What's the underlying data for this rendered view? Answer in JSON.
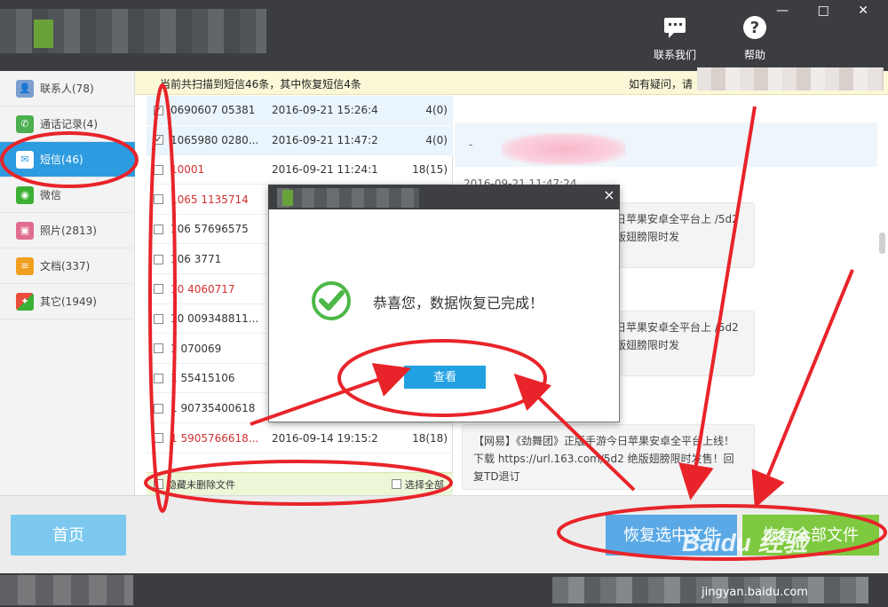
{
  "header": {
    "contact_label": "联系我们",
    "help_label": "帮助",
    "window_controls": "— □ ✕"
  },
  "banner": {
    "text": "当前共扫描到短信46条，其中恢复短信4条",
    "help_text": "如有疑问，请"
  },
  "sidebar": {
    "items": [
      {
        "label": "联系人(78)",
        "icon": "contacts-icon",
        "color": "#7a9fd0"
      },
      {
        "label": "通话记录(4)",
        "icon": "call-log-icon",
        "color": "#4caf50"
      },
      {
        "label": "短信(46)",
        "icon": "sms-icon",
        "color": "#ffffff"
      },
      {
        "label": "微信",
        "icon": "wechat-icon",
        "color": "#3cb034"
      },
      {
        "label": "照片(2813)",
        "icon": "photo-icon",
        "color": "#e06d8f"
      },
      {
        "label": "文档(337)",
        "icon": "document-icon",
        "color": "#f0a020"
      },
      {
        "label": "其它(1949)",
        "icon": "other-icon",
        "color": "#e94e3c"
      }
    ]
  },
  "messages": [
    {
      "checked": true,
      "number": "0690607 05381",
      "red": false,
      "date": "2016-09-21 15:26:4",
      "count": "4(0)"
    },
    {
      "checked": true,
      "number": "1065980 0280...",
      "red": false,
      "date": "2016-09-21 11:47:2",
      "count": "4(0)"
    },
    {
      "checked": false,
      "number": "10001",
      "red": true,
      "date": "2016-09-21 11:24:1",
      "count": "18(15)"
    },
    {
      "checked": false,
      "number": "1065 1135714",
      "red": true,
      "date": "",
      "count": ""
    },
    {
      "checked": false,
      "number": "106 57696575",
      "red": false,
      "date": "",
      "count": ""
    },
    {
      "checked": false,
      "number": "106 3771",
      "red": false,
      "date": "",
      "count": ""
    },
    {
      "checked": false,
      "number": "10 4060717",
      "red": true,
      "date": "",
      "count": ""
    },
    {
      "checked": false,
      "number": "10 009348811...",
      "red": false,
      "date": "",
      "count": ""
    },
    {
      "checked": false,
      "number": "1 070069",
      "red": false,
      "date": "",
      "count": ""
    },
    {
      "checked": false,
      "number": "1 55415106",
      "red": false,
      "date": "",
      "count": ""
    },
    {
      "checked": false,
      "number": "1 90735400618",
      "red": false,
      "date": "",
      "count": ""
    },
    {
      "checked": false,
      "number": "1 5905766618...",
      "red": true,
      "date": "2016-09-14 19:15:2",
      "count": "18(18)"
    }
  ],
  "list_footer": {
    "hide_label": "隐藏未删除文件",
    "select_all_label": "选择全部"
  },
  "detail": {
    "dash": "-",
    "timestamp": "2016-09-21 11:47:24",
    "bubble1": "今日苹果安卓全平台上 /5d2 绝版翅膀限时发",
    "bubble2": "今日苹果安卓全平台上 /5d2 绝版翅膀限时发",
    "bubble3": "【网易】《劲舞团》正版手游今日苹果安卓全平台上线！下载 https://url.163.com/5d2 绝版翅膀限时发售！回复TD退订"
  },
  "modal": {
    "message": "恭喜您，数据恢复已完成！",
    "view_label": "查看",
    "close": "×"
  },
  "bottom": {
    "home_label": "首页",
    "recover_selected_label": "恢复选中文件",
    "recover_all_label": "恢复全部文件"
  },
  "watermark": {
    "text": "Baidu 经验",
    "url": "jingyan.baidu.com"
  },
  "colors": {
    "accent_blue": "#2d9be0",
    "annotation_red": "#e8242a",
    "success_green": "#4db848",
    "recover_all_green": "#7ec93f"
  }
}
